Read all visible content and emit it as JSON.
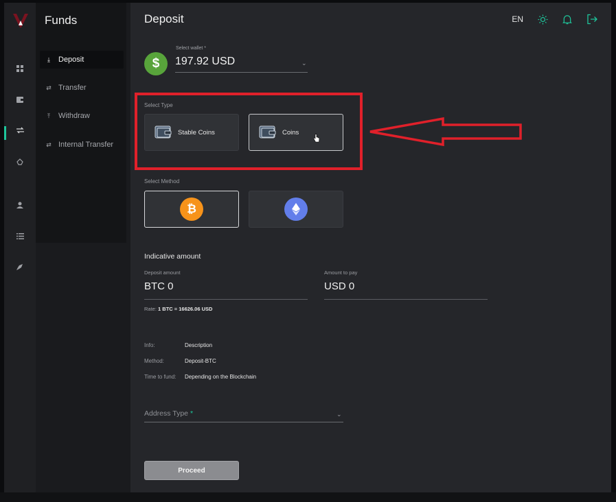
{
  "sidebar": {
    "title": "Funds",
    "items": [
      {
        "label": "Deposit",
        "icon": "download-icon",
        "glyph": "⤓",
        "active": true
      },
      {
        "label": "Transfer",
        "icon": "transfer-icon",
        "glyph": "⇄",
        "active": false
      },
      {
        "label": "Withdraw",
        "icon": "upload-icon",
        "glyph": "⤒",
        "active": false
      },
      {
        "label": "Internal Transfer",
        "icon": "transfer-icon",
        "glyph": "⇄",
        "active": false
      }
    ]
  },
  "rail": {
    "icons": [
      "dashboard-icon",
      "wallet-icon",
      "exchange-icon",
      "earn-icon",
      "user-icon",
      "list-icon",
      "rocket-icon"
    ],
    "active_color": "#1ec79c"
  },
  "header": {
    "title": "Deposit",
    "lang": "EN"
  },
  "wallet": {
    "label": "Select wallet *",
    "value": "197.92 USD",
    "coin_glyph": "$",
    "coin_color": "#58a43b"
  },
  "select_type": {
    "label": "Select Type",
    "options": [
      {
        "label": "Stable Coins",
        "selected": false
      },
      {
        "label": "Coins",
        "selected": true
      }
    ]
  },
  "select_method": {
    "label": "Select Method",
    "options": [
      {
        "name": "bitcoin-icon",
        "glyph": "₿",
        "color": "#f7931a",
        "selected": true
      },
      {
        "name": "ethereum-icon",
        "glyph": "◆",
        "color": "#627eea",
        "selected": false
      }
    ]
  },
  "indicative": {
    "heading": "Indicative amount",
    "deposit_label": "Deposit amount",
    "deposit_value": "BTC 0",
    "pay_label": "Amount to pay",
    "pay_value": "USD 0",
    "rate_prefix": "Rate:",
    "rate_value": "1 BTC = 16626.06 USD"
  },
  "info": [
    {
      "key": "Info:",
      "value": "Description"
    },
    {
      "key": "Method:",
      "value": "Deposit-BTC"
    },
    {
      "key": "Time to fund:",
      "value": "Depending on the Blockchain"
    }
  ],
  "address": {
    "label": "Address Type",
    "required_mark": "*"
  },
  "proceed_label": "Proceed",
  "annotation_color": "#e0202a"
}
